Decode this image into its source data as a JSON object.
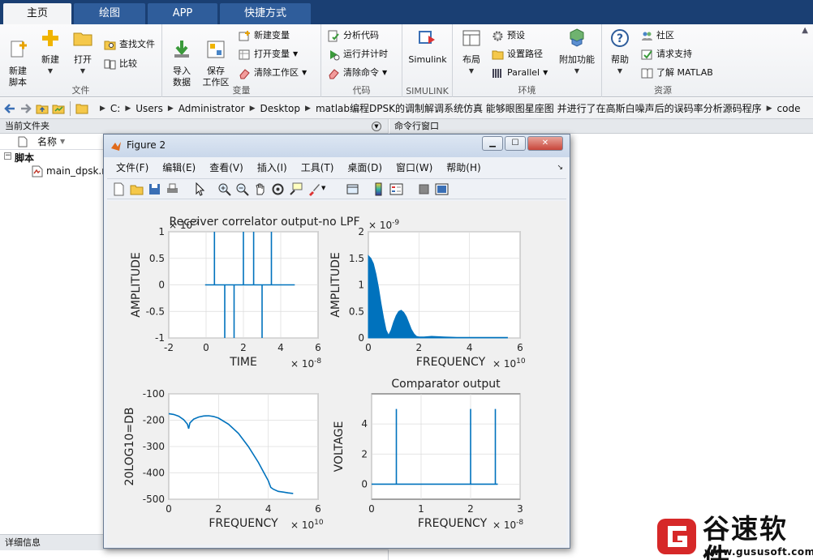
{
  "tabs": [
    {
      "label": "主页",
      "active": true
    },
    {
      "label": "绘图",
      "active": false
    },
    {
      "label": "APP",
      "active": false
    },
    {
      "label": "快捷方式",
      "active": false
    }
  ],
  "ribbon": {
    "file": {
      "label": "文件",
      "new_script": "新建\n脚本",
      "new": "新建",
      "open": "打开",
      "find_files": "查找文件",
      "compare": "比较"
    },
    "variable": {
      "label": "变量",
      "import_data": "导入\n数据",
      "save_workspace": "保存\n工作区",
      "new_variable": "新建变量",
      "open_variable": "打开变量",
      "clear_workspace": "清除工作区"
    },
    "code": {
      "label": "代码",
      "analyze_code": "分析代码",
      "run_and_time": "运行并计时",
      "clear_commands": "清除命令"
    },
    "simulink": {
      "label": "SIMULINK",
      "simulink": "Simulink"
    },
    "environment": {
      "label": "环境",
      "layout": "布局",
      "preferences": "预设",
      "set_path": "设置路径",
      "parallel": "Parallel",
      "addons": "附加功能"
    },
    "resources": {
      "label": "资源",
      "help": "帮助",
      "community": "社区",
      "request_support": "请求支持",
      "learn_matlab": "了解 MATLAB"
    }
  },
  "address": {
    "crumbs": [
      "C:",
      "Users",
      "Administrator",
      "Desktop",
      "matlab编程DPSK的调制解调系统仿真 能够眼图星座图 并进行了在高斯白噪声后的误码率分析源码程序",
      "code"
    ]
  },
  "left_panel": {
    "title": "当前文件夹",
    "name_column": "名称",
    "tree_group": "脚本",
    "tree_file": "main_dpsk.m",
    "details_title": "详细信息"
  },
  "command_window": {
    "title": "命令行窗口"
  },
  "figure": {
    "title": "Figure 2",
    "menu": [
      "文件(F)",
      "编辑(E)",
      "查看(V)",
      "插入(I)",
      "工具(T)",
      "桌面(D)",
      "窗口(W)",
      "帮助(H)"
    ],
    "toolbar_icons": [
      "new-figure-icon",
      "open-file-icon",
      "save-icon",
      "print-icon",
      "pointer-icon",
      "zoom-in-icon",
      "zoom-out-icon",
      "pan-icon",
      "rotate-icon",
      "data-cursor-icon",
      "brush-icon",
      "link-icon",
      "colorbar-icon",
      "legend-icon",
      "hide-plot-tools-icon",
      "show-plot-tools-icon"
    ],
    "series_color": "#0072bd"
  },
  "chart_data": [
    {
      "type": "line",
      "title": "Receiver correlator output-no LPF",
      "xlabel": "TIME",
      "ylabel": "AMPLITUDE",
      "x_exponent": "× 10^-8",
      "y_exponent": "× 10^-7",
      "xlim": [
        -2,
        6
      ],
      "ylim": [
        -1,
        1
      ],
      "xticks": [
        "-2",
        "0",
        "2",
        "4",
        "6"
      ],
      "yticks": [
        "-1",
        "-0.5",
        "0",
        "0.5",
        "1"
      ],
      "series": [
        {
          "x": [
            -0.05,
            0.45,
            0.45,
            0.45,
            1.0,
            1.0,
            1.0,
            1.5,
            1.5,
            1.5,
            2.0,
            2.0,
            2.0,
            2.55,
            2.55,
            2.55,
            3.0,
            3.0,
            3.0,
            3.5,
            3.5,
            3.5,
            4.75
          ],
          "y": [
            0,
            0,
            1,
            0,
            0,
            -1,
            0,
            0,
            -1,
            0,
            0,
            1,
            0,
            0,
            1,
            0,
            0,
            -1,
            0,
            0,
            1,
            0,
            0
          ]
        }
      ]
    },
    {
      "type": "area",
      "xlabel": "FREQUENCY",
      "ylabel": "AMPLITUDE",
      "x_exponent": "× 10^10",
      "y_exponent": "× 10^-9",
      "xlim": [
        0,
        6
      ],
      "ylim": [
        0,
        2
      ],
      "xticks": [
        "0",
        "2",
        "4",
        "6"
      ],
      "yticks": [
        "0",
        "0.5",
        "1",
        "1.5",
        "2"
      ],
      "series": [
        {
          "x": [
            0,
            0.1,
            0.2,
            0.3,
            0.4,
            0.5,
            0.6,
            0.7,
            0.8,
            0.9,
            1.0,
            1.1,
            1.2,
            1.3,
            1.4,
            1.5,
            1.6,
            1.7,
            1.8,
            1.9,
            2.0,
            2.2,
            2.5,
            3.0,
            3.5,
            4.0,
            4.5,
            5.0,
            5.5
          ],
          "y": [
            1.55,
            1.5,
            1.4,
            1.2,
            0.95,
            0.65,
            0.38,
            0.15,
            0.05,
            0.15,
            0.3,
            0.42,
            0.5,
            0.52,
            0.48,
            0.4,
            0.28,
            0.16,
            0.08,
            0.03,
            0.02,
            0.02,
            0.03,
            0.02,
            0.01,
            0.01,
            0.01,
            0.01,
            0.01
          ]
        }
      ]
    },
    {
      "type": "line",
      "xlabel": "FREQUENCY",
      "ylabel": "20LOG10=DB",
      "x_exponent": "× 10^10",
      "xlim": [
        0,
        6
      ],
      "ylim": [
        -500,
        -100
      ],
      "xticks": [
        "0",
        "2",
        "4",
        "6"
      ],
      "yticks": [
        "-500",
        "-400",
        "-300",
        "-200",
        "-100"
      ],
      "series": [
        {
          "x": [
            0,
            0.2,
            0.4,
            0.6,
            0.75,
            0.8,
            0.85,
            1.0,
            1.2,
            1.4,
            1.6,
            1.8,
            2.0,
            2.4,
            2.8,
            3.2,
            3.6,
            3.8,
            4.0,
            4.1,
            4.2,
            4.4,
            4.6,
            4.8,
            5.0
          ],
          "y": [
            -175,
            -178,
            -185,
            -198,
            -215,
            -232,
            -210,
            -196,
            -188,
            -184,
            -183,
            -186,
            -192,
            -215,
            -250,
            -300,
            -360,
            -395,
            -430,
            -455,
            -462,
            -470,
            -473,
            -476,
            -478
          ]
        }
      ]
    },
    {
      "type": "line",
      "title": "Comparator output",
      "xlabel": "FREQUENCY",
      "ylabel": "VOLTAGE",
      "x_exponent": "× 10^-8",
      "xlim": [
        0,
        3
      ],
      "ylim": [
        -1,
        6
      ],
      "xticks": [
        "0",
        "1",
        "2",
        "3"
      ],
      "yticks": [
        "0",
        "2",
        "4"
      ],
      "series": [
        {
          "x": [
            0,
            0.5,
            0.5,
            0.5,
            2.0,
            2.0,
            2.0,
            2.5,
            2.5,
            2.5,
            2.55
          ],
          "y": [
            0,
            0,
            5,
            0,
            0,
            5,
            0,
            0,
            5,
            0,
            0
          ]
        }
      ]
    }
  ],
  "watermark": {
    "brand": "谷速软件",
    "url": "www.gususoft.com"
  }
}
